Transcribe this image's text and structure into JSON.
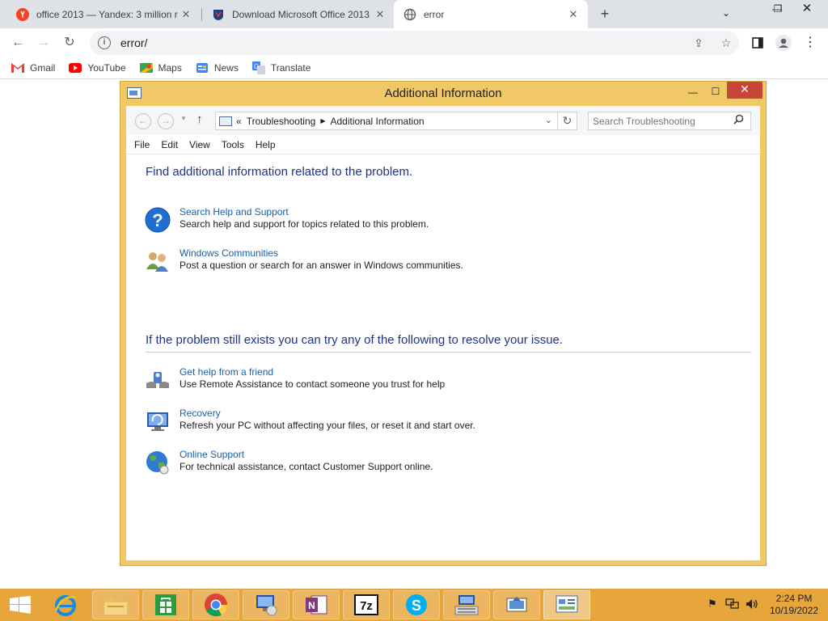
{
  "browser": {
    "tabs": [
      {
        "title": "office 2013 — Yandex: 3 million r",
        "icon": "yandex-icon",
        "active": false
      },
      {
        "title": "Download Microsoft Office 2013",
        "icon": "shield-favicon-icon",
        "active": false
      },
      {
        "title": "error",
        "icon": "globe-icon",
        "active": true
      }
    ],
    "address": "error/",
    "bookmarks": [
      {
        "label": "Gmail",
        "icon": "gmail-icon"
      },
      {
        "label": "YouTube",
        "icon": "youtube-icon"
      },
      {
        "label": "Maps",
        "icon": "maps-icon"
      },
      {
        "label": "News",
        "icon": "news-icon"
      },
      {
        "label": "Translate",
        "icon": "translate-icon"
      }
    ]
  },
  "explorer": {
    "title": "Additional Information",
    "breadcrumb": [
      "Troubleshooting",
      "Additional Information"
    ],
    "breadcrumb_prefix": "«",
    "search_placeholder": "Search Troubleshooting",
    "menu": [
      "File",
      "Edit",
      "View",
      "Tools",
      "Help"
    ],
    "section1": {
      "heading": "Find additional information related to the problem.",
      "items": [
        {
          "link": "Search Help and Support",
          "desc": "Search help and support for topics related to this problem.",
          "icon": "help-question-icon"
        },
        {
          "link": "Windows Communities",
          "desc": "Post a question or search for an answer in Windows communities.",
          "icon": "people-icon"
        }
      ]
    },
    "section2": {
      "heading": "If the problem still exists you can try any of the following to resolve your issue.",
      "items": [
        {
          "link": "Get help from a friend",
          "desc": "Use Remote Assistance to contact someone you trust for help",
          "icon": "remote-assistance-icon"
        },
        {
          "link": "Recovery",
          "desc": "Refresh your PC without affecting your files, or reset it and start over.",
          "icon": "recovery-icon"
        },
        {
          "link": "Online Support",
          "desc": "For technical assistance, contact Customer Support online.",
          "icon": "globe-support-icon"
        }
      ]
    }
  },
  "taskbar": {
    "time": "2:24 PM",
    "date": "10/19/2022",
    "onenote_label": "N",
    "sevenzip_label": "7z",
    "skype_label": "S",
    "colors": {
      "taskbar": "#e7a63c",
      "window_frame": "#f0c865",
      "link": "#1a5fa6",
      "heading": "#1e3287",
      "close": "#c7463a"
    }
  }
}
